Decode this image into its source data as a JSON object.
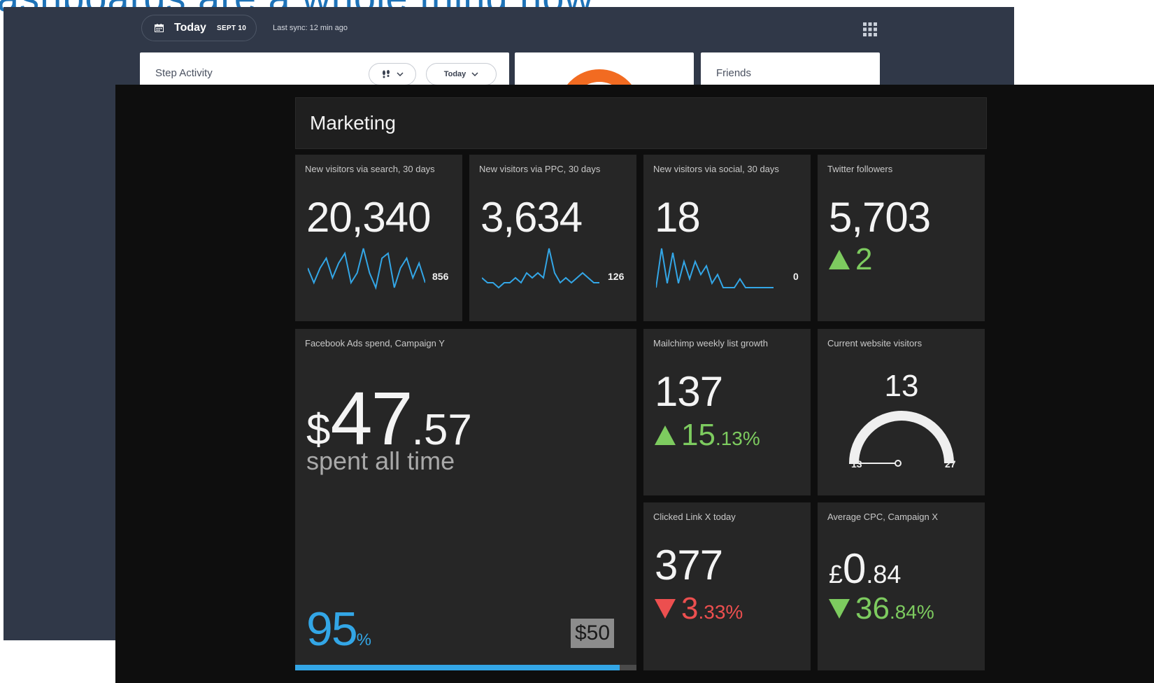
{
  "background_heading": "ashboards are a whole thing now",
  "back_dashboard": {
    "header": {
      "today_label": "Today",
      "date_label": "SEPT 10",
      "sync_text": "Last sync: 12 min ago",
      "calendar_icon": "calendar-icon",
      "apps_icon": "apps-grid-icon"
    },
    "step_card": {
      "title": "Step Activity",
      "metric_dropdown_value": "!!",
      "range_dropdown_value": "Today"
    },
    "friends_card": {
      "title": "Friends"
    },
    "accent_color": "#f26b21"
  },
  "front_dashboard": {
    "title": "Marketing",
    "tiles": {
      "search": {
        "title": "New visitors via search, 30 days",
        "value": "20,340",
        "spark_label": "856",
        "spark": [
          6,
          3,
          6,
          8,
          4,
          7,
          9,
          3,
          5,
          10,
          5,
          2,
          8,
          9,
          2,
          6,
          8,
          4,
          7,
          3
        ]
      },
      "ppc": {
        "title": "New visitors via PPC, 30 days",
        "value": "3,634",
        "spark_label": "126",
        "spark": [
          3,
          2,
          2,
          1,
          2,
          2,
          3,
          2,
          4,
          3,
          4,
          3,
          9,
          4,
          2,
          3,
          2,
          3,
          4,
          3,
          2,
          2
        ]
      },
      "social": {
        "title": "New visitors via social, 30 days",
        "value": "18",
        "spark_label": "0",
        "spark": [
          1,
          10,
          2,
          9,
          2,
          7,
          3,
          7,
          4,
          6,
          2,
          4,
          1,
          1,
          1,
          3,
          1,
          1,
          1,
          1,
          1,
          1
        ]
      },
      "twitter": {
        "title": "Twitter followers",
        "value": "5,703",
        "delta": "2"
      },
      "facebook": {
        "title": "Facebook Ads spend, Campaign Y",
        "currency": "$",
        "amount_main": "47",
        "amount_dec": ".57",
        "caption": "spent all time",
        "percent": "95",
        "percent_sign": "%",
        "goal": "$50",
        "progress": 0.95
      },
      "mailchimp": {
        "title": "Mailchimp weekly list growth",
        "value": "137",
        "delta_main": "15",
        "delta_dec": ".13%"
      },
      "visitors": {
        "title": "Current website visitors",
        "value": "13",
        "min": "13",
        "max": "27",
        "level": 0
      },
      "clicked": {
        "title": "Clicked Link X today",
        "value": "377",
        "delta_main": "3",
        "delta_dec": ".33%"
      },
      "cpc": {
        "title": "Average CPC, Campaign X",
        "currency": "£",
        "value_main": "0",
        "value_dec": ".84",
        "delta_main": "36",
        "delta_dec": ".84%"
      }
    },
    "colors": {
      "accent_blue": "#33a6e6",
      "up_green": "#7dcb5f",
      "down_red": "#ec4f4f"
    }
  }
}
